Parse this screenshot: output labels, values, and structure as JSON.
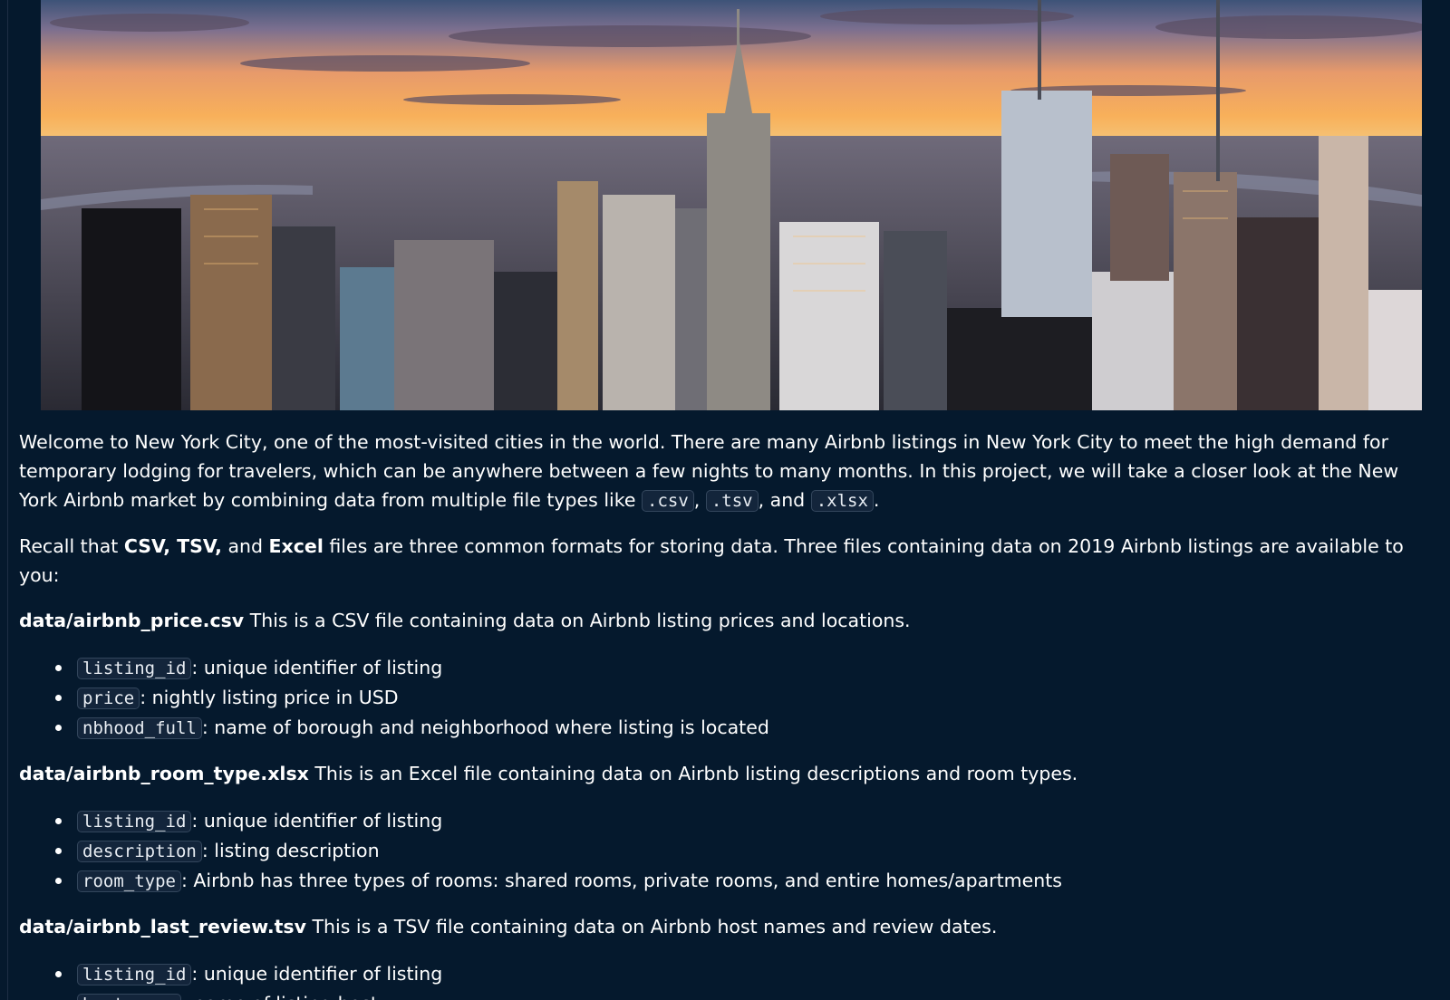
{
  "hero": {
    "image_description": "New York City skyline at sunset"
  },
  "intro": {
    "text_1": "Welcome to New York City, one of the most-visited cities in the world. There are many Airbnb listings in New York City to meet the high demand for temporary lodging for travelers, which can be anywhere between a few nights to many months. In this project, we will take a closer look at the New York Airbnb market by combining data from multiple file types like ",
    "code_csv": ".csv",
    "sep_1": ", ",
    "code_tsv": ".tsv",
    "sep_2": ", and ",
    "code_xlsx": ".xlsx",
    "end": "."
  },
  "recall": {
    "text_1": "Recall that ",
    "bold_1": "CSV, TSV,",
    "text_2": " and ",
    "bold_2": "Excel",
    "text_3": " files are three common formats for storing data. Three files containing data on 2019 Airbnb listings are available to you:"
  },
  "files": [
    {
      "name": "data/airbnb_price.csv",
      "description": " This is a CSV file containing data on Airbnb listing prices and locations.",
      "columns": [
        {
          "code": "listing_id",
          "text": ": unique identifier of listing"
        },
        {
          "code": "price",
          "text": ": nightly listing price in USD"
        },
        {
          "code": "nbhood_full",
          "text": ": name of borough and neighborhood where listing is located"
        }
      ]
    },
    {
      "name": "data/airbnb_room_type.xlsx",
      "description": " This is an Excel file containing data on Airbnb listing descriptions and room types.",
      "columns": [
        {
          "code": "listing_id",
          "text": ": unique identifier of listing"
        },
        {
          "code": "description",
          "text": ": listing description"
        },
        {
          "code": "room_type",
          "text": ": Airbnb has three types of rooms: shared rooms, private rooms, and entire homes/apartments"
        }
      ]
    },
    {
      "name": "data/airbnb_last_review.tsv",
      "description": " This is a TSV file containing data on Airbnb host names and review dates.",
      "columns": [
        {
          "code": "listing_id",
          "text": ": unique identifier of listing"
        },
        {
          "code": "host_name",
          "text": ": name of listing host"
        }
      ]
    }
  ]
}
